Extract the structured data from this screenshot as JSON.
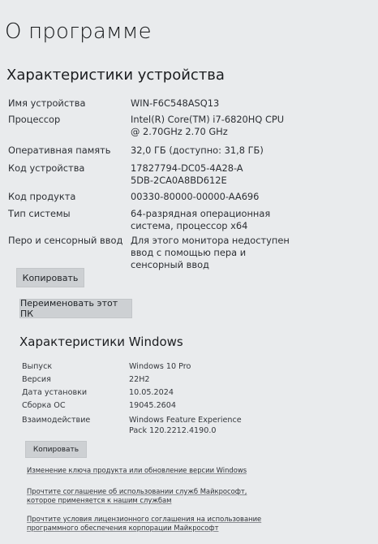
{
  "page_title": "О программе",
  "device_section": {
    "title": "Характеристики устройства",
    "rows": [
      {
        "label": "Имя устройства",
        "value": "WIN-F6C548ASQ13"
      },
      {
        "label": "Процессор",
        "value": "Intel(R) Core(TM) i7-6820HQ CPU @ 2.70GHz   2.70 GHz"
      },
      {
        "label": "Оперативная память",
        "value": "32,0 ГБ (доступно: 31,8 ГБ)"
      },
      {
        "label": "Код устройства",
        "value": "17827794-DC05-4A28-A5DB-2CA0A8BD612E"
      },
      {
        "label": "Код продукта",
        "value": "00330-80000-00000-AA696"
      },
      {
        "label": "Тип системы",
        "value": "64-разрядная операционная система, процессор x64"
      },
      {
        "label": "Перо и сенсорный ввод",
        "value": "Для этого монитора недоступен ввод с помощью пера и сенсорный ввод"
      }
    ],
    "copy_label": "Копировать",
    "rename_label": "Переименовать этот ПК"
  },
  "windows_section": {
    "title": "Характеристики Windows",
    "rows": [
      {
        "label": "Выпуск",
        "value": "Windows 10 Pro"
      },
      {
        "label": "Версия",
        "value": "22H2"
      },
      {
        "label": "Дата установки",
        "value": "10.05.2024"
      },
      {
        "label": "Сборка ОС",
        "value": "19045.2604"
      },
      {
        "label": "Взаимодействие",
        "value": "Windows Feature Experience Pack 120.2212.4190.0"
      }
    ],
    "copy_label": "Копировать"
  },
  "links": [
    "Изменение ключа продукта или обновление версии Windows",
    "Прочтите соглашение об использовании служб Майкрософт, которое применяется к нашим службам",
    "Прочтите условия лицензионного соглашения на использование программного обеспечения корпорации Майкрософт"
  ]
}
